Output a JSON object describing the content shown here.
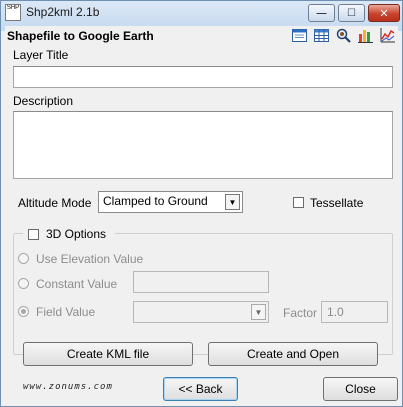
{
  "window": {
    "title": "Shp2kml 2.1b",
    "icon_text": "SHP",
    "controls": {
      "minimize": "—",
      "maximize": "☐",
      "close": "✕"
    }
  },
  "header": {
    "title": "Shapefile to Google Earth",
    "toolbar_icons": [
      "window-icon",
      "table-icon",
      "zoom-icon",
      "bar-chart-icon",
      "line-chart-icon"
    ]
  },
  "form": {
    "layer_title_label": "Layer Title",
    "layer_title_value": "",
    "description_label": "Description",
    "description_value": "",
    "altitude_mode_label": "Altitude Mode",
    "altitude_mode_value": "Clamped to Ground",
    "tessellate_label": "Tessellate",
    "tessellate_checked": false
  },
  "options_3d": {
    "label": "3D Options",
    "checked": false,
    "use_elevation_label": "Use Elevation Value",
    "constant_value_label": "Constant Value",
    "constant_value": "",
    "field_value_label": "Field Value",
    "field_value": "",
    "factor_label": "Factor",
    "factor_value": "1.0"
  },
  "buttons": {
    "create_kml": "Create KML file",
    "create_open": "Create and Open",
    "back": "<< Back",
    "close": "Close"
  },
  "watermark": "www.zonums.com",
  "colors": {
    "title_gradient_top": "#dbe8f6",
    "close_red": "#c8442d",
    "client_bg": "#f0f0f0"
  }
}
